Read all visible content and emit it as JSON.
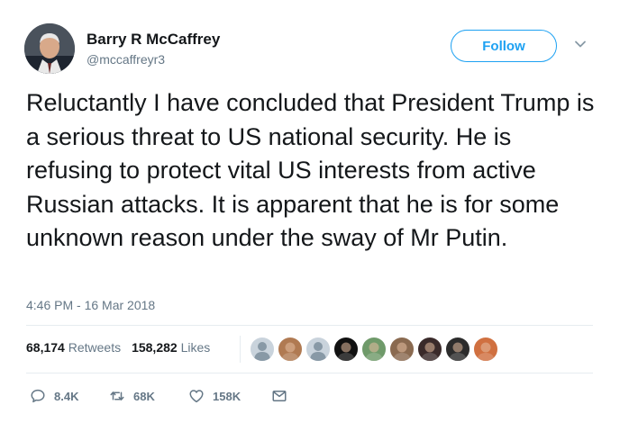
{
  "profile": {
    "name": "Barry R McCaffrey",
    "handle": "@mccaffreyr3",
    "follow_label": "Follow"
  },
  "tweet": {
    "text": "Reluctantly I have concluded that President Trump is a serious threat to US national security. He is refusing to protect vital US interests from active Russian attacks. It is apparent that he is for some unknown reason under the sway of Mr Putin.",
    "timestamp": "4:46 PM - 16 Mar 2018"
  },
  "stats": {
    "retweets_count": "68,174",
    "retweets_label": "Retweets",
    "likes_count": "158,282",
    "likes_label": "Likes"
  },
  "likers": [
    {
      "icon": "default-avatar-icon",
      "color": "#c9d3dc"
    },
    {
      "icon": "avatar-photo",
      "color": "#b07a52"
    },
    {
      "icon": "default-avatar-icon",
      "color": "#c9d3dc"
    },
    {
      "icon": "avatar-photo",
      "color": "#111111"
    },
    {
      "icon": "avatar-photo",
      "color": "#6f9a6a"
    },
    {
      "icon": "avatar-photo",
      "color": "#8a6a50"
    },
    {
      "icon": "avatar-photo",
      "color": "#3a2a2a"
    },
    {
      "icon": "avatar-photo",
      "color": "#2c2c2c"
    },
    {
      "icon": "avatar-photo",
      "color": "#d07040"
    }
  ],
  "actions": {
    "replies": "8.4K",
    "retweets": "68K",
    "likes": "158K"
  },
  "colors": {
    "accent": "#1da1f2",
    "text": "#14171a",
    "secondary": "#657786",
    "divider": "#e6ecf0"
  }
}
